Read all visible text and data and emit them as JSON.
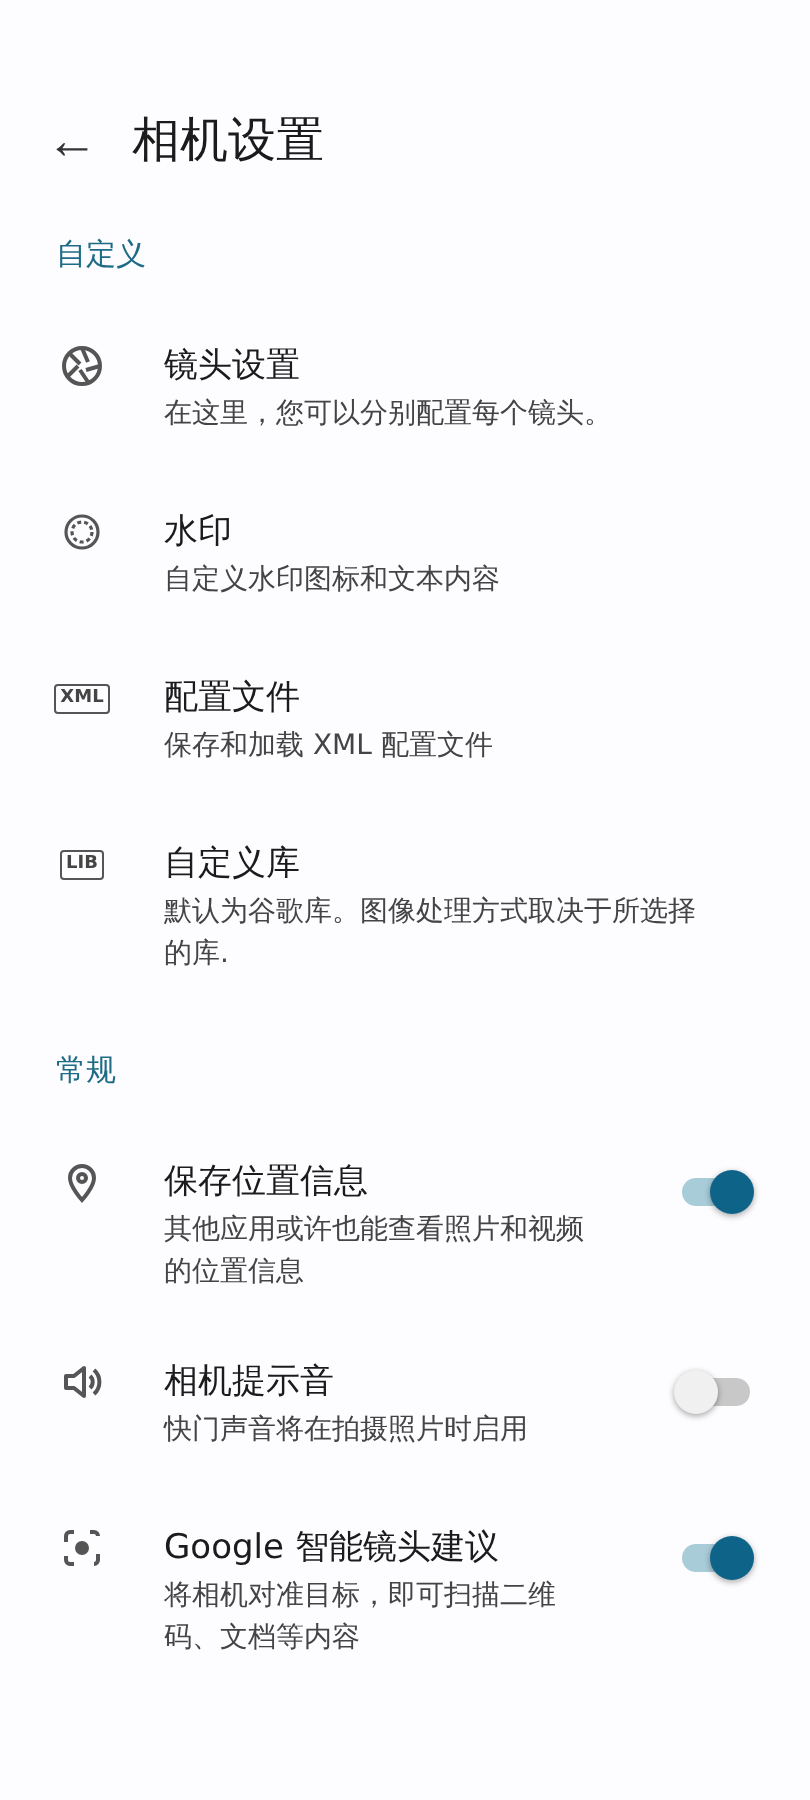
{
  "header": {
    "back": "←",
    "title": "相机设置"
  },
  "sections": [
    {
      "title": "自定义",
      "items": [
        {
          "kind": "link",
          "title": "镜头设置",
          "subtitle": "在这里，您可以分别配置每个镜头。"
        },
        {
          "kind": "link",
          "title": "水印",
          "subtitle": "自定义水印图标和文本内容"
        },
        {
          "kind": "link",
          "icon_text": "XML",
          "title": "配置文件",
          "subtitle": "保存和加载 XML 配置文件"
        },
        {
          "kind": "link",
          "icon_text": "LIB",
          "title": "自定义库",
          "subtitle": "默认为谷歌库。图像处理方式取决于所选择的库."
        }
      ]
    },
    {
      "title": "常规",
      "items": [
        {
          "kind": "toggle",
          "title": "保存位置信息",
          "subtitle": "其他应用或许也能查看照片和视频的位置信息",
          "on": true
        },
        {
          "kind": "toggle",
          "title": "相机提示音",
          "subtitle": "快门声音将在拍摄照片时启用",
          "on": false
        },
        {
          "kind": "toggle",
          "title": "Google 智能镜头建议",
          "subtitle": "将相机对准目标，即可扫描二维码、文档等内容",
          "on": true
        }
      ]
    }
  ]
}
